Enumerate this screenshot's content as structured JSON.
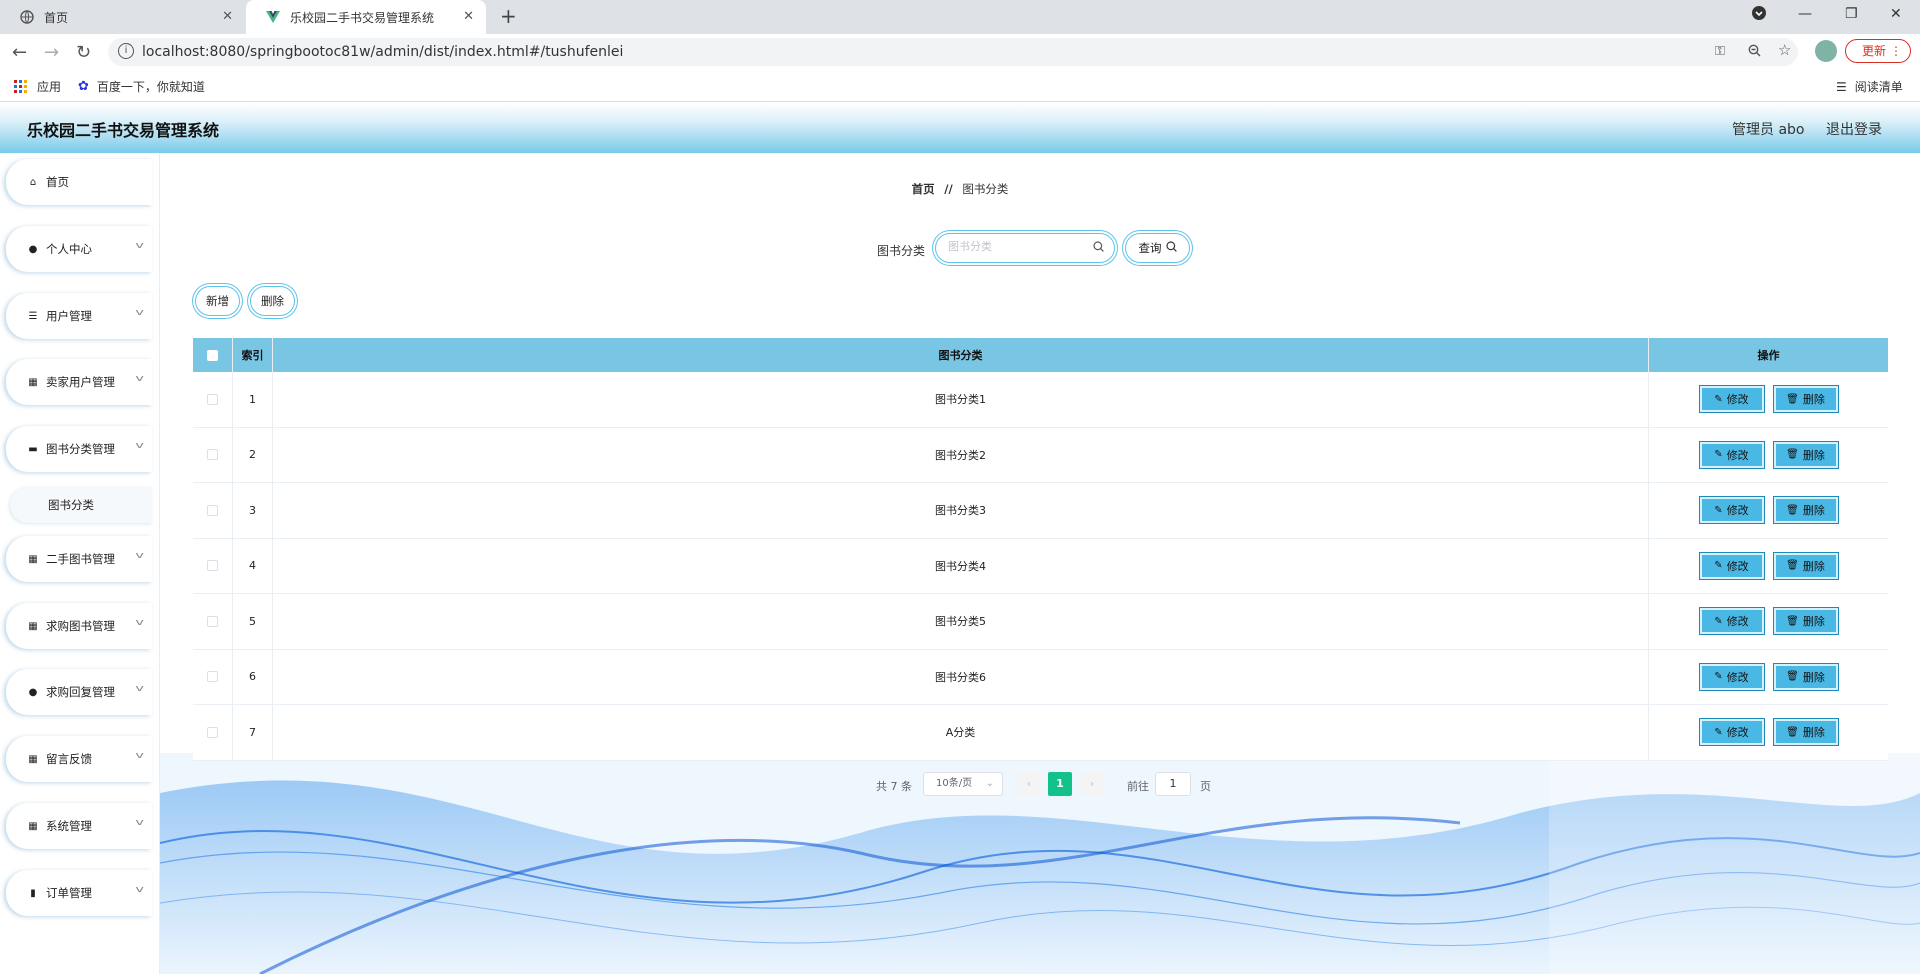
{
  "browser": {
    "tabs": [
      {
        "title": "首页"
      },
      {
        "title": "乐校园二手书交易管理系统"
      }
    ],
    "url": "localhost:8080/springbootoc81w/admin/dist/index.html#/tushufenlei",
    "update_label": "更新",
    "bookmarks": {
      "apps": "应用",
      "baidu": "百度一下，你就知道",
      "reading_list": "阅读清单"
    }
  },
  "header": {
    "title": "乐校园二手书交易管理系统",
    "admin": "管理员 abo",
    "logout": "退出登录"
  },
  "sidebar": {
    "items": [
      {
        "label": "首页",
        "icon": "home-icon"
      },
      {
        "label": "个人中心",
        "icon": "user-icon"
      },
      {
        "label": "用户管理",
        "icon": "sliders-icon"
      },
      {
        "label": "卖家用户管理",
        "icon": "grid-icon"
      },
      {
        "label": "图书分类管理",
        "icon": "briefcase-icon"
      },
      {
        "label": "二手图书管理",
        "icon": "grid-icon"
      },
      {
        "label": "求购图书管理",
        "icon": "grid-icon"
      },
      {
        "label": "求购回复管理",
        "icon": "user-icon"
      },
      {
        "label": "留言反馈",
        "icon": "grid-icon"
      },
      {
        "label": "系统管理",
        "icon": "grid-icon"
      },
      {
        "label": "订单管理",
        "icon": "bar-chart-icon"
      }
    ],
    "active_sub": "图书分类"
  },
  "breadcrumb": {
    "home": "首页",
    "separator": "//",
    "current": "图书分类"
  },
  "search": {
    "label": "图书分类",
    "placeholder": "图书分类",
    "query_button": "查询"
  },
  "actions": {
    "add": "新增",
    "delete": "删除"
  },
  "table": {
    "headers": {
      "index": "索引",
      "category": "图书分类",
      "operation": "操作"
    },
    "rows": [
      {
        "index": "1",
        "category": "图书分类1"
      },
      {
        "index": "2",
        "category": "图书分类2"
      },
      {
        "index": "3",
        "category": "图书分类3"
      },
      {
        "index": "4",
        "category": "图书分类4"
      },
      {
        "index": "5",
        "category": "图书分类5"
      },
      {
        "index": "6",
        "category": "图书分类6"
      },
      {
        "index": "7",
        "category": "A分类"
      }
    ],
    "edit_label": "修改",
    "delete_label": "删除"
  },
  "pagination": {
    "total": "共 7 条",
    "page_size": "10条/页",
    "current_page": "1",
    "goto_label": "前往",
    "goto_value": "1",
    "page_unit": "页"
  },
  "colors": {
    "header_gradient_end": "#79cbea",
    "table_header": "#79c6e4",
    "op_button": "#4ab8e5",
    "active_page": "#13c18a"
  }
}
